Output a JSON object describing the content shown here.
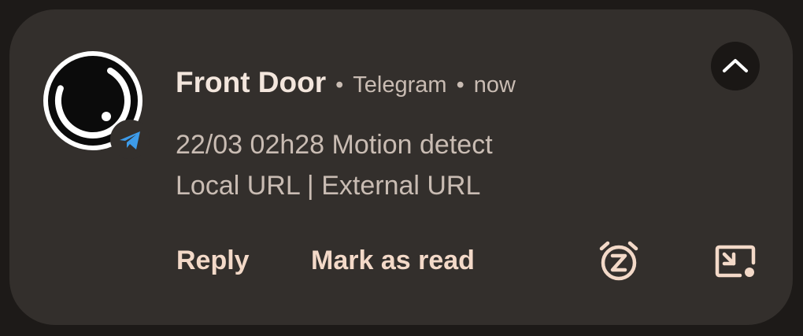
{
  "notification": {
    "title": "Front Door",
    "app_name": "Telegram",
    "time": "now",
    "separator": "•",
    "message_line1": "22/03 02h28 Motion detect",
    "message_line2": "Local URL | External URL",
    "avatar_icon": "camera-lens-icon",
    "app_icon": "telegram-icon"
  },
  "actions": {
    "reply_label": "Reply",
    "mark_read_label": "Mark as read",
    "snooze_icon": "snooze-alarm-icon",
    "pip_icon": "picture-in-picture-icon",
    "expand_icon": "chevron-up-icon"
  },
  "colors": {
    "card_background": "#332f2c",
    "page_background": "#1d1a18",
    "title_text": "#f3e6dd",
    "secondary_text": "#c9bcb3",
    "action_text": "#f3d9c8",
    "telegram_blue": "#3d9be9"
  }
}
